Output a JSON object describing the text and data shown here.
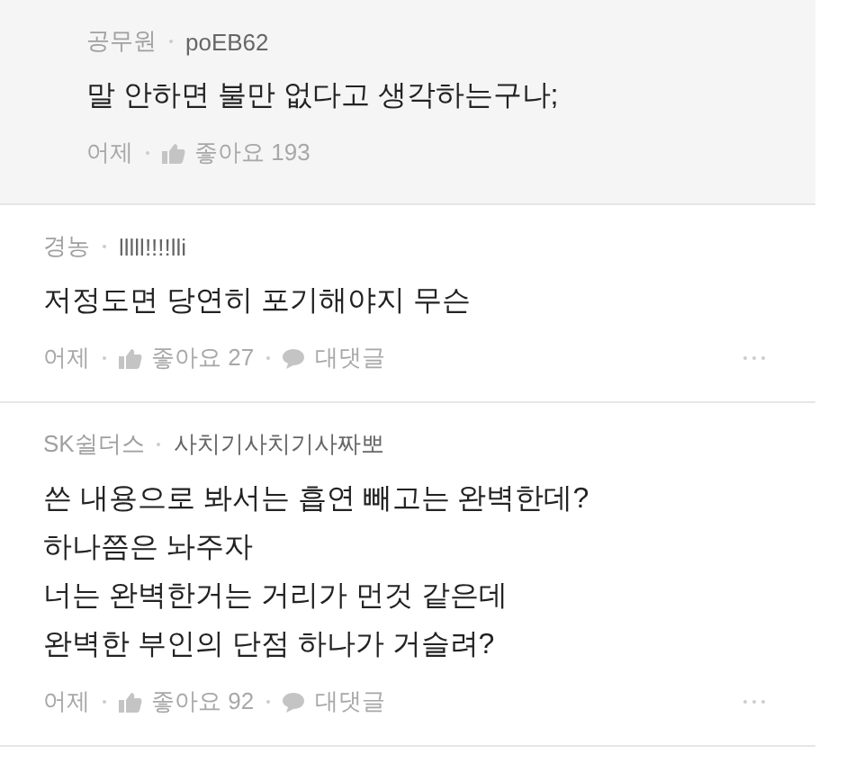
{
  "comments": [
    {
      "kind": "reply",
      "badge": "공무원",
      "author": "poEB62",
      "text": "말 안하면 불만 없다고 생각하는구나;",
      "time": "어제",
      "likes": "좋아요 193",
      "more": false
    },
    {
      "kind": "comment",
      "badge": "경농",
      "author": "lllll!!!!lli",
      "text": "저정도면 당연히 포기해야지 무슨",
      "time": "어제",
      "likes": "좋아요 27",
      "reply_label": "대댓글",
      "more": true
    },
    {
      "kind": "comment",
      "badge": "SK쉴더스",
      "author": "사치기사치기사짜뽀",
      "text": "쓴 내용으로 봐서는 흡연 빼고는 완벽한데?\n하나쯤은 놔주자\n너는 완벽한거는 거리가 먼것 같은데\n완벽한 부인의 단점 하나가 거슬려?",
      "time": "어제",
      "likes": "좋아요 92",
      "reply_label": "대댓글",
      "more": true
    }
  ]
}
